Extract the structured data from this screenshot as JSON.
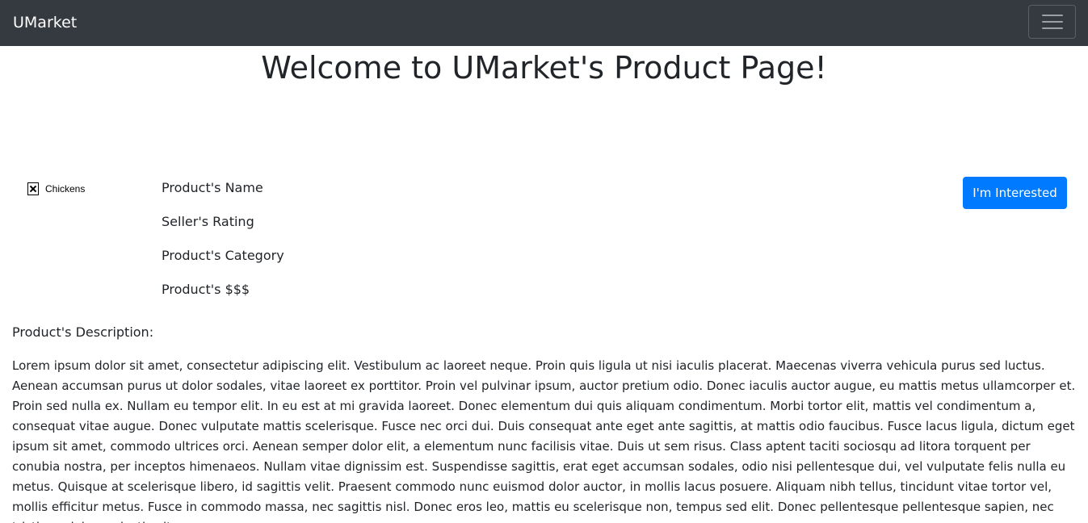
{
  "navbar": {
    "brand": "UMarket",
    "menu_toggle_icon": "hamburger-menu-icon"
  },
  "page": {
    "title": "Welcome to UMarket's Product Page!"
  },
  "product": {
    "image_alt": "Chickens",
    "image_icon": "broken-image-icon",
    "name_label": "Product's Name",
    "rating_label": "Seller's Rating",
    "category_label": "Product's Category",
    "price_label": "Product's $$$",
    "interested_button": "I'm Interested",
    "description_label": "Product's Description:",
    "description": "Lorem ipsum dolor sit amet, consectetur adipiscing elit. Vestibulum ac laoreet neque. Proin quis ligula ut nisi iaculis placerat. Maecenas viverra vehicula purus sed luctus. Aenean accumsan purus ut dolor sodales, vitae laoreet ex porttitor. Proin vel pulvinar ipsum, auctor pretium odio. Donec iaculis auctor augue, eu mattis metus ullamcorper et. Proin sed nulla ex. Nullam eu tempor elit. In eu est at mi gravida laoreet. Donec elementum dui quis aliquam condimentum. Morbi tortor elit, mattis vel condimentum a, consequat vitae augue. Donec vulputate mattis scelerisque. Fusce nec orci dui. Duis consequat ante eget ante sagittis, at mattis odio faucibus. Fusce lacus ligula, dictum eget ipsum sit amet, commodo ultrices orci. Aenean semper dolor elit, a elementum nunc facilisis vitae. Duis ut sem risus. Class aptent taciti sociosqu ad litora torquent per conubia nostra, per inceptos himenaeos. Nullam vitae dignissim est. Suspendisse sagittis, erat eget accumsan sodales, odio nisi pellentesque dui, vel vulputate felis nulla eu metus. Quisque at scelerisque libero, id sagittis velit. Praesent commodo nunc euismod dolor auctor, in mollis lacus posuere. Aliquam nibh tellus, tincidunt vitae tortor vel, mollis efficitur metus. Fusce in commodo massa, nec sagittis nisl. Donec eros leo, mattis eu scelerisque non, tempus sed elit. Donec pellentesque pellentesque sapien, nec tristique dolor molestie sit"
  },
  "colors": {
    "navbar_bg": "#343a40",
    "primary_button": "#007bff"
  }
}
